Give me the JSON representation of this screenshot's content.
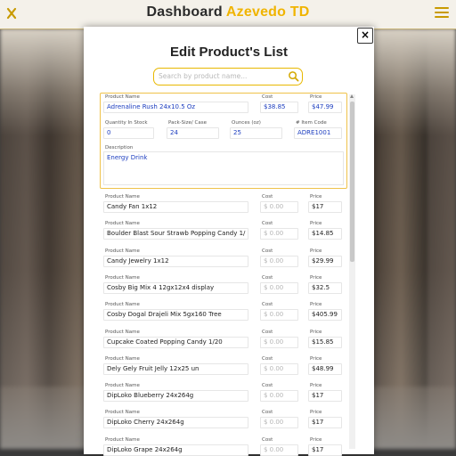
{
  "header": {
    "title_main": "Dashboard",
    "title_accent": "Azevedo TD",
    "menu_icon": "hamburger-menu-icon",
    "back_icon": "menu-toggle-icon",
    "accent_color": "#f0b400"
  },
  "modal": {
    "title": "Edit Product's List",
    "close_label": "×",
    "search_placeholder": "Search by product name..."
  },
  "labels": {
    "product_name": "Product Name",
    "cost": "Cost",
    "price": "Price",
    "qty": "Quantity In Stock",
    "pack": "Pack-Size/ Case",
    "ounces": "Ounces (oz)",
    "item_code": "# Item Code",
    "description": "Description",
    "cost_placeholder": "$ 0.00"
  },
  "selected_product": {
    "name": "Adrenaline Rush 24x10.5 Oz",
    "cost": "$38.85",
    "price": "$47.99",
    "qty": "0",
    "pack": "24",
    "ounces": "25",
    "item_code": "ADRE1001",
    "description": "Energy Drink"
  },
  "products": [
    {
      "name": "Candy Fan 1x12",
      "price": "$17"
    },
    {
      "name": "Boulder Blast Sour Strawb Popping Candy 1/",
      "price": "$14.85"
    },
    {
      "name": "Candy Jewelry 1x12",
      "price": "$29.99"
    },
    {
      "name": "Cosby Big Mix 4 12gx12x4 display",
      "price": "$32.5"
    },
    {
      "name": "Cosby Dogal Drajeli Mix 5gx160 Tree",
      "price": "$405.99"
    },
    {
      "name": "Cupcake Coated Popping Candy 1/20",
      "price": "$15.85"
    },
    {
      "name": "Dely Gely Fruit Jelly 12x25 un",
      "price": "$48.99"
    },
    {
      "name": "DipLoko Blueberry 24x264g",
      "price": "$17"
    },
    {
      "name": "DipLoko Cherry 24x264g",
      "price": "$17"
    },
    {
      "name": "DipLoko Grape 24x264g",
      "price": "$17"
    }
  ]
}
